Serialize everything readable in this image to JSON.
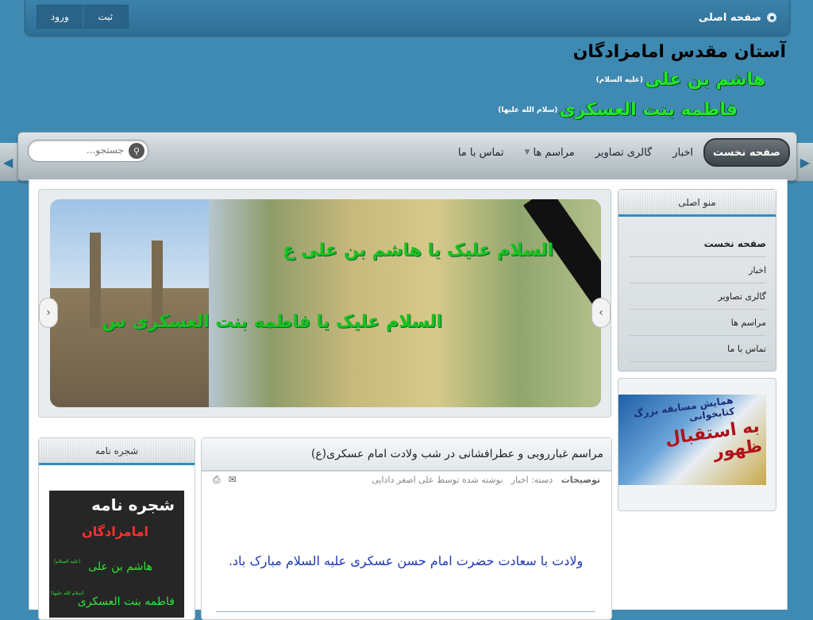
{
  "top": {
    "home_label": "صفحه اصلی",
    "login_label": "ورود",
    "register_label": "ثبت"
  },
  "header": {
    "title": "آستان مقدس امامزادگان",
    "name1": "هاشم بن علی",
    "name1_suffix": "(علیه السلام)",
    "name2": "فاطمه بنت العسکری",
    "name2_suffix": "(سلام الله علیها)"
  },
  "nav": {
    "items": [
      {
        "label": "صفحه نخست",
        "active": true
      },
      {
        "label": "اخبار"
      },
      {
        "label": "گالری تصاویر"
      },
      {
        "label": "مراسم ها",
        "has_submenu": true
      },
      {
        "label": "تماس با ما"
      }
    ],
    "search_placeholder": "جستجو..."
  },
  "slider": {
    "caption1": "السلام علیک یا هاشم بن علی ع",
    "caption2": "السلام علیک یا فاطمه بنت العسکری س"
  },
  "menu_box": {
    "title": "منو اصلی",
    "items": [
      "صفحه نخست",
      "اخبار",
      "گالری تصاویر",
      "مراسم ها",
      "تماس با ما"
    ]
  },
  "ad": {
    "text_main": "به استقبال ظهور",
    "text_small": "همایش مسابقه بزرگ کتابخوانی"
  },
  "article": {
    "title": "مراسم غبارروبی و عطرافشانی در شب ولادت امام عسکری(ع)",
    "meta_details": "توضیحات",
    "meta_category_label": "دسته:",
    "meta_category": "اخبار",
    "meta_author": "نوشته شده توسط علی اصغر دادایی",
    "body": "ولادت با سعادت حضرت امام حسن عسکری علیه السلام مبارک باد."
  },
  "tree_box": {
    "title": "شجره نامه",
    "img_title": "شجره نامه",
    "img_line1": "امامزادگان",
    "img_line2": "هاشم بن علی",
    "img_line3": "فاطمه بنت العسکری",
    "img_small1": "(علیه السلام)",
    "img_small2": "(سلام الله علیها)"
  }
}
